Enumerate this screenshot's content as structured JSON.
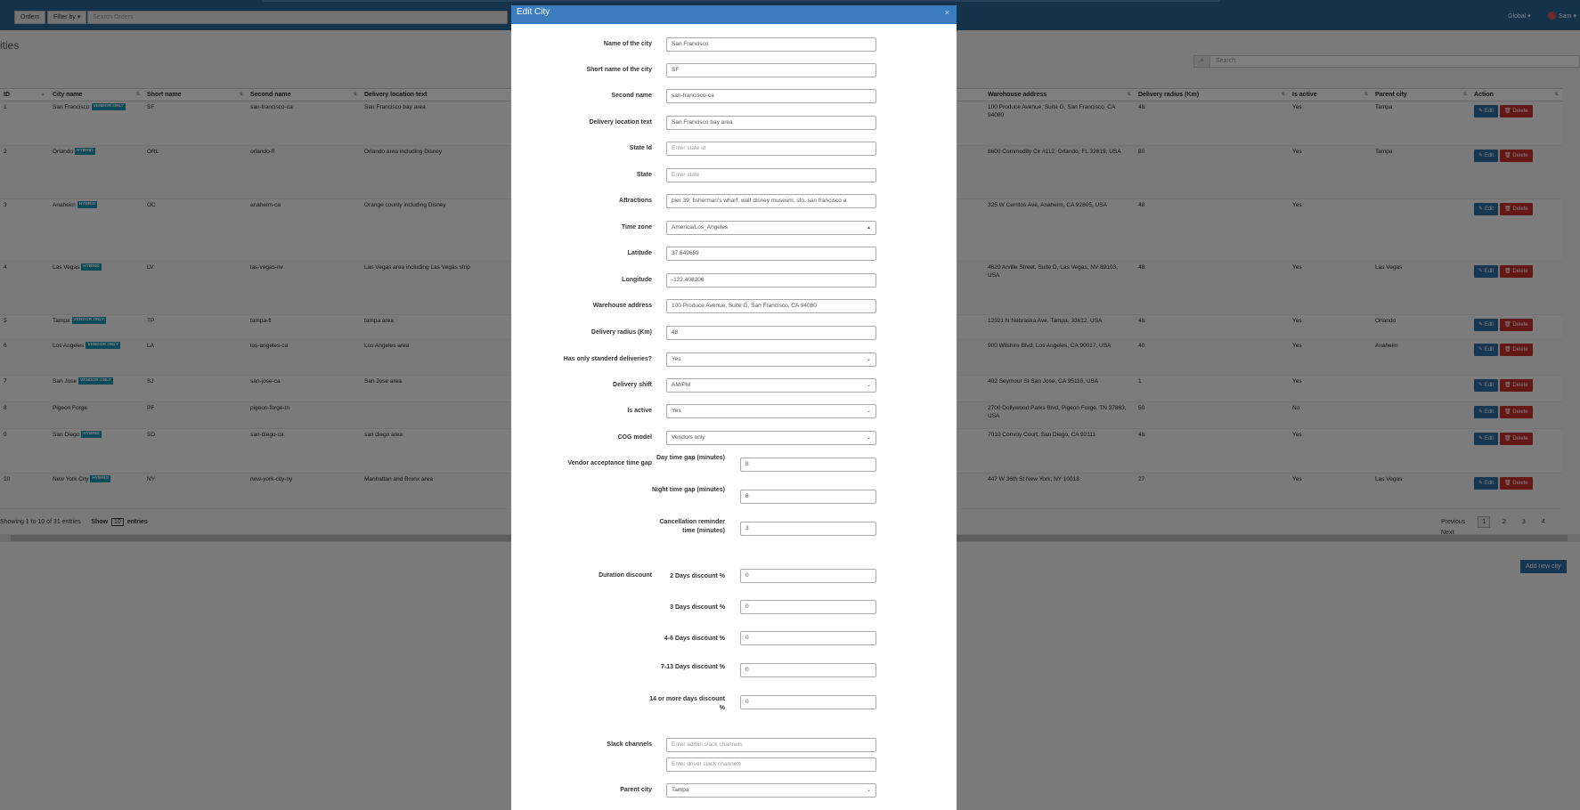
{
  "topbar": {
    "orders_label": "Orders",
    "filter_label": "Filter by ▾",
    "search_placeholder": "Search Orders",
    "global_label": "Global ▾",
    "user_label": "Sam ▾"
  },
  "page": {
    "title": "ities",
    "search_placeholder": "Search"
  },
  "table": {
    "headers_left": [
      "ID",
      "City name",
      "Short name",
      "Second name",
      "Delivery location text"
    ],
    "headers_right": [
      "Warehouse address",
      "Delivery radius (Km)",
      "Is active",
      "Parent city",
      "Action"
    ],
    "rows": [
      {
        "id": "1",
        "city": "San Francisco",
        "tag": "VENDOR ONLY",
        "short": "SF",
        "second": "san-francisco-ca",
        "loc": "San Francisco bay area",
        "wh": "100 Produce Avenue, Suite G, San Francisco, CA 94080",
        "radius": "48",
        "active": "Yes",
        "parent": "Tampa"
      },
      {
        "id": "2",
        "city": "Orlando",
        "tag": "HYBRID",
        "short": "ORL",
        "second": "orlando-fl",
        "loc": "Orlando area including Disney",
        "wh": "8600 Commodity Cir #112, Orlando, FL 32819, USA",
        "radius": "80",
        "active": "Yes",
        "parent": "Tampa"
      },
      {
        "id": "3",
        "city": "Anaheim",
        "tag": "HYBRID",
        "short": "OC",
        "second": "anaheim-ca",
        "loc": "Orange county including Disney",
        "wh": "325 W Cerritos Ave, Anaheim, CA 92805, USA",
        "radius": "48",
        "active": "Yes",
        "parent": ""
      },
      {
        "id": "4",
        "city": "Las Vegas",
        "tag": "HYBRID",
        "short": "LV",
        "second": "las-vegas-nv",
        "loc": "Las Vegas area including Las Vegas strip",
        "wh": "4620 Arville Street, Suite D, Las Vegas, NV 89103, USA",
        "radius": "48",
        "active": "Yes",
        "parent": "Las Vegas"
      },
      {
        "id": "5",
        "city": "Tampa",
        "tag": "VENDOR ONLY",
        "short": "TP",
        "second": "tampa-fl",
        "loc": "tampa area",
        "wh": "12921 N Nebraska Ave, Tampa, 33612, USA",
        "radius": "48",
        "active": "Yes",
        "parent": "Orlando"
      },
      {
        "id": "6",
        "city": "Los Angeles",
        "tag": "VENDOR ONLY",
        "short": "LA",
        "second": "los-angeles-ca",
        "loc": "Los Angeles area",
        "wh": "900 Wilshire Blvd, Los Angeles, CA 90017, USA",
        "radius": "40",
        "active": "Yes",
        "parent": "Anaheim"
      },
      {
        "id": "7",
        "city": "San Jose",
        "tag": "VENDOR ONLY",
        "short": "SJ",
        "second": "san-jose-ca",
        "loc": "San Jose area",
        "wh": "402 Seymour St San Jose, CA 95110, USA",
        "radius": "1",
        "active": "Yes",
        "parent": ""
      },
      {
        "id": "8",
        "city": "Pigeon Forge",
        "tag": "",
        "short": "PF",
        "second": "pigeon-forge-tn",
        "loc": "",
        "wh": "2700 Dollywood Parks Blvd, Pigeon Forge, TN 37863, USA",
        "radius": "50",
        "active": "No",
        "parent": ""
      },
      {
        "id": "9",
        "city": "San Diego",
        "tag": "HYBRID",
        "short": "SD",
        "second": "san-diego-ca",
        "loc": "san diego area",
        "wh": "7010 Convoy Court, San Diego, CA 92111",
        "radius": "48",
        "active": "Yes",
        "parent": ""
      },
      {
        "id": "10",
        "city": "New York City",
        "tag": "HYBRID",
        "short": "NY",
        "second": "new-york-city-ny",
        "loc": "Manhattan and Bronx area",
        "wh": "447 W 36th St New York, NY 10018",
        "radius": "27",
        "active": "Yes",
        "parent": "Las Vegas"
      }
    ],
    "edit_label": "Edit",
    "delete_label": "Delete"
  },
  "footer": {
    "showing_text": "Showing 1 to 10 of 31 entries",
    "show_label": "Show",
    "show_value": "10",
    "entries_label": "entries",
    "pages": [
      "Previous",
      "1",
      "2",
      "3",
      "4",
      "Next"
    ],
    "add_button": "Add new city"
  },
  "modal": {
    "title": "Edit City",
    "close": "×",
    "fields": [
      {
        "label": "Name of the city",
        "value": "San Francisco",
        "placeholder": false
      },
      {
        "label": "Short name of the city",
        "value": "SF",
        "placeholder": false
      },
      {
        "label": "Second name",
        "value": "san-francisco-ca",
        "placeholder": false
      },
      {
        "label": "Delivery location text",
        "value": "San Francisco bay area",
        "placeholder": false
      },
      {
        "label": "State Id",
        "value": "Enter state id",
        "placeholder": true
      },
      {
        "label": "State",
        "value": "Enter state",
        "placeholder": true
      },
      {
        "label": "Attractions",
        "value": "pier 39, fisherman's wharf, walt disney museum, sfo, san francisco a",
        "placeholder": false
      },
      {
        "label": "Time zone",
        "value": "America/Los_Angeles",
        "placeholder": false
      },
      {
        "label": "Latitude",
        "value": "37.649659",
        "placeholder": false
      },
      {
        "label": "Longitude",
        "value": "-122.408206",
        "placeholder": false
      },
      {
        "label": "Warehouse address",
        "value": "100 Produce Avenue, Suite G, San Francisco, CA 94080",
        "placeholder": false
      },
      {
        "label": "Delivery radius (Km)",
        "value": "48",
        "placeholder": false
      },
      {
        "label": "Has only standerd deliveries?",
        "value": "Yes",
        "placeholder": false
      },
      {
        "label": "Delivery shift",
        "value": "AM/PM",
        "placeholder": false
      },
      {
        "label": "Is active",
        "value": "Yes",
        "placeholder": false
      },
      {
        "label": "COG model",
        "value": "Vendors only",
        "placeholder": false
      }
    ],
    "vendor_gap": {
      "label": "Vendor acceptance time gap",
      "items": [
        {
          "label": "Day time gap (minutes)",
          "value": "8"
        },
        {
          "label": "Night time gap (minutes)",
          "value": "8"
        },
        {
          "label": "Cancellation reminder time (minutes)",
          "value": "3"
        }
      ]
    },
    "duration_discount": {
      "label": "Duration discount",
      "items": [
        {
          "label": "2 Days discount %",
          "value": "0"
        },
        {
          "label": "3 Days discount %",
          "value": "0"
        },
        {
          "label": "4-6 Days discount %",
          "value": "0"
        },
        {
          "label": "7-13 Days discount %",
          "value": "0"
        },
        {
          "label": "14 or more days discount %",
          "value": "0"
        }
      ]
    },
    "slack": {
      "label": "Slack channels",
      "admin_placeholder": "Enter admin slack channels",
      "driver_placeholder": "Enter driver slack channels"
    },
    "parent_city": {
      "label": "Parent city",
      "value": "Tampa"
    }
  }
}
